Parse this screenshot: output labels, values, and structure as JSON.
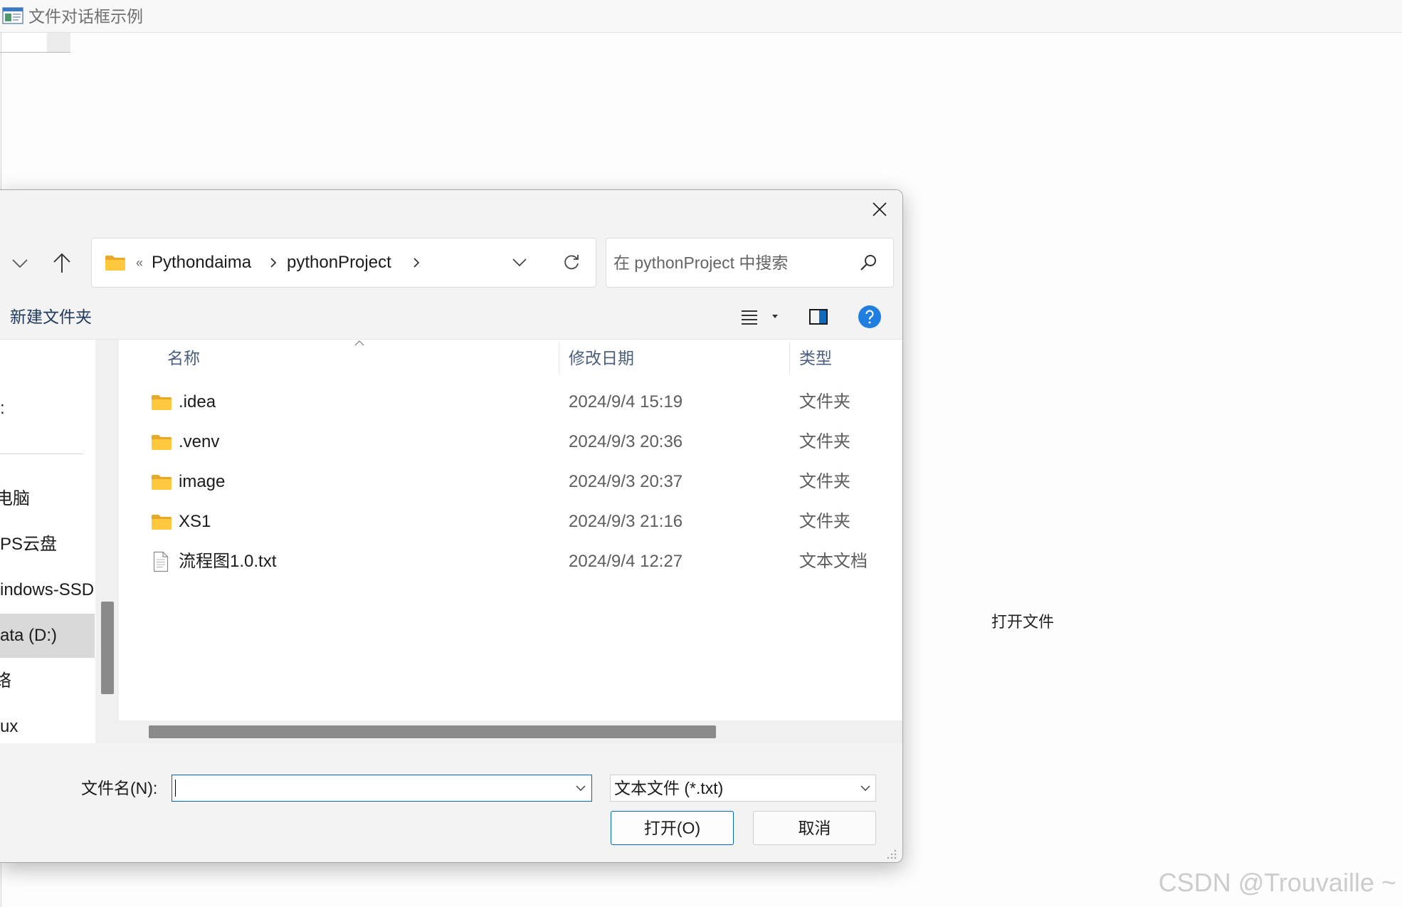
{
  "window": {
    "title": "文件对话框示例",
    "app_icon": "app-window-icon",
    "open_file_text": "打开文件"
  },
  "watermark": "CSDN @Trouvaille ~",
  "dialog": {
    "close_icon": "close-icon",
    "nav_buttons": {
      "recent_icon": "chevron-down-icon",
      "up_icon": "arrow-up-icon"
    },
    "address": {
      "folder_icon": "folder-icon",
      "overflow_marker": "«",
      "path": [
        "Pythondaima",
        "pythonProject"
      ],
      "separator_icon": "chevron-right-icon",
      "history_icon": "chevron-down-icon",
      "refresh_icon": "refresh-icon"
    },
    "search": {
      "placeholder": "在 pythonProject 中搜索",
      "icon": "search-icon"
    },
    "toolbar": {
      "new_folder": "新建文件夹",
      "view_icon": "list-view-icon",
      "view_menu_icon": "caret-down-icon",
      "preview_pane_icon": "preview-pane-icon",
      "help_icon": "help-icon"
    },
    "nav": {
      "items": [
        ":",
        "电脑",
        "PS云盘",
        "indows-SSD",
        "ata (D:)",
        "络",
        "ux"
      ],
      "selected_index": 4
    },
    "columns": {
      "name": "名称",
      "modified": "修改日期",
      "type": "类型",
      "sort_icon": "sort-ascending-icon"
    },
    "files": [
      {
        "name": ".idea",
        "modified": "2024/9/4 15:19",
        "type": "文件夹",
        "icon": "folder-icon"
      },
      {
        "name": ".venv",
        "modified": "2024/9/3 20:36",
        "type": "文件夹",
        "icon": "folder-icon"
      },
      {
        "name": "image",
        "modified": "2024/9/3 20:37",
        "type": "文件夹",
        "icon": "folder-icon"
      },
      {
        "name": "XS1",
        "modified": "2024/9/3 21:16",
        "type": "文件夹",
        "icon": "folder-icon"
      },
      {
        "name": "流程图1.0.txt",
        "modified": "2024/9/4 12:27",
        "type": "文本文档",
        "icon": "text-file-icon"
      }
    ],
    "footer": {
      "filename_label": "文件名(N):",
      "filename_value": "",
      "filter": "文本文件 (*.txt)",
      "open": "打开(O)",
      "cancel": "取消"
    }
  },
  "colors": {
    "accent": "#0067c0",
    "help_blue": "#1f7ee0",
    "folder_yellow": "#ffc83d",
    "selected_nav_bg": "#d9d9d9",
    "header_text": "#4a5f80",
    "watermark": "#cccccc"
  }
}
